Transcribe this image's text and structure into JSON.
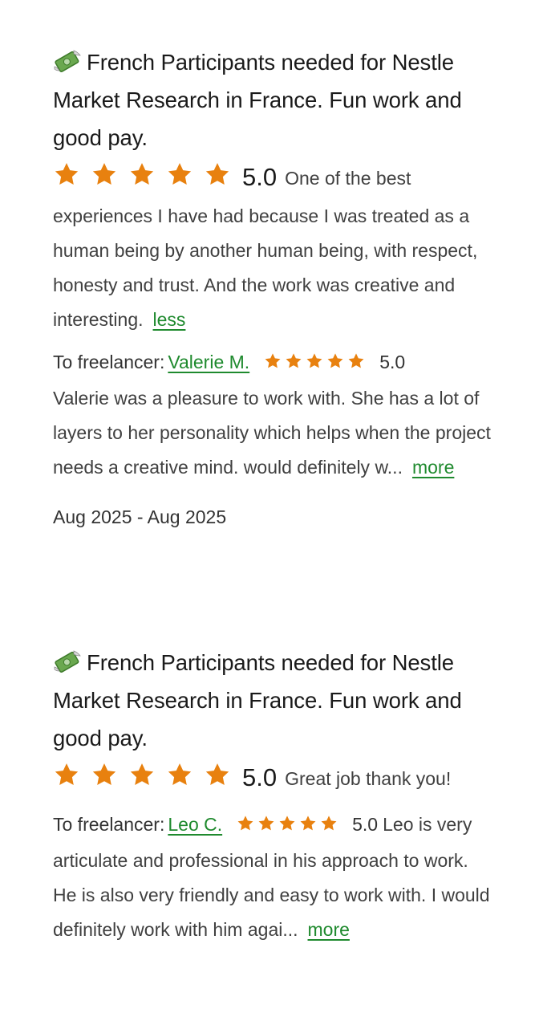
{
  "reviews": [
    {
      "job_title": "French Participants needed for Nestle Market Research in France. Fun work and good pay.",
      "job_icon": "money-with-wings-icon",
      "client_rating": "5.0",
      "client_rating_value": 5,
      "client_feedback": "One of the best experiences I have had because I was treated as a human being by another human being, with respect, honesty and trust. And the work was creative and interesting.",
      "client_feedback_toggle": "less",
      "to_freelancer_label": "To freelancer:",
      "freelancer_name": "Valerie M.",
      "freelancer_rating": "5.0",
      "freelancer_rating_value": 5,
      "freelancer_feedback": "Valerie was a pleasure to work with. She has a lot of layers to her personality which helps when the project needs a creative mind. would definitely w...",
      "freelancer_feedback_toggle": "more",
      "date_range": "Aug 2025 - Aug 2025"
    },
    {
      "job_title": "French Participants needed for Nestle Market Research in France. Fun work and good pay.",
      "job_icon": "money-with-wings-icon",
      "client_rating": "5.0",
      "client_rating_value": 5,
      "client_feedback": "Great job thank you!",
      "to_freelancer_label": "To freelancer:",
      "freelancer_name": "Leo C.",
      "freelancer_rating": "5.0",
      "freelancer_rating_value": 5,
      "freelancer_feedback": "Leo is very articulate and professional in his approach to work. He is also very friendly and easy to work with. I would definitely work with him agai...",
      "freelancer_feedback_toggle": "more"
    }
  ],
  "colors": {
    "star": "#e8810f",
    "link": "#1f8a2e",
    "text": "#404040",
    "title": "#1a1a1a"
  }
}
